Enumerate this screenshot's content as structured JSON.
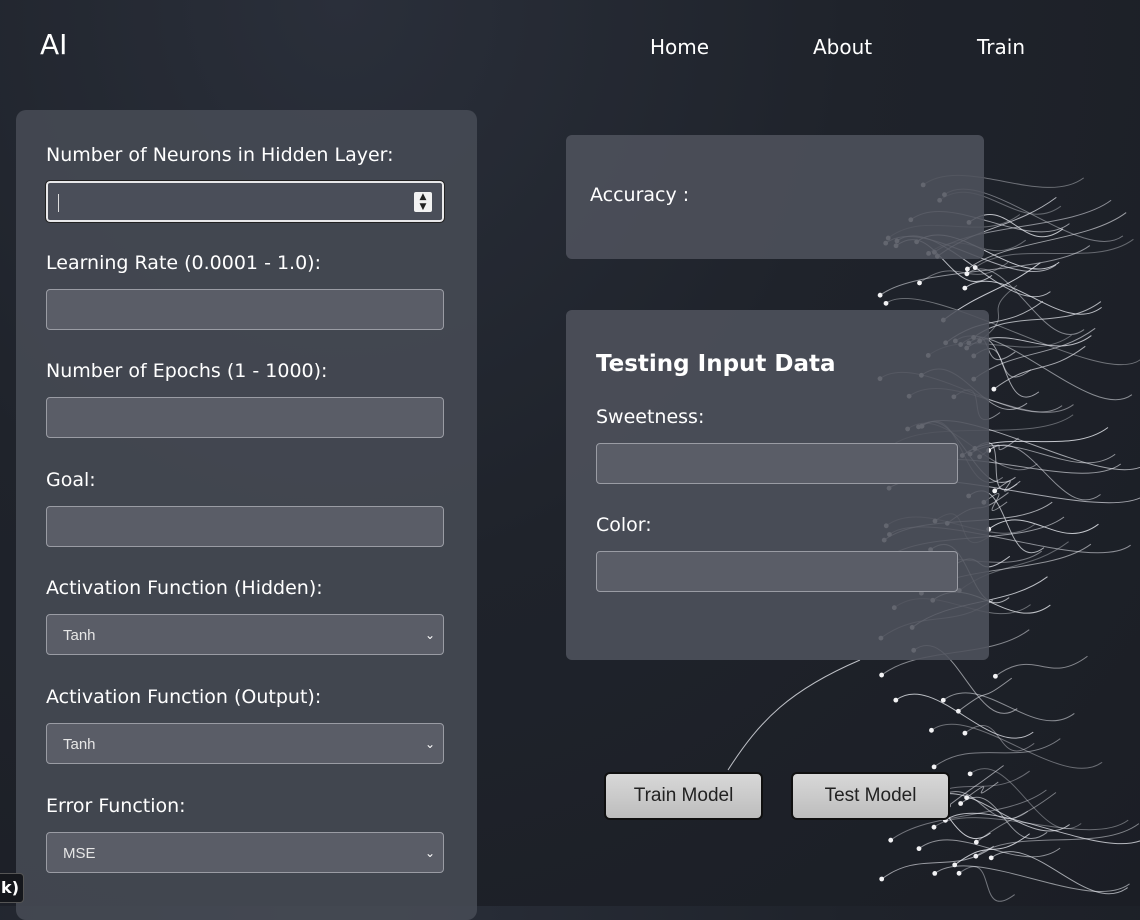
{
  "header": {
    "logo": "AI",
    "nav": [
      "Home",
      "About",
      "Train"
    ]
  },
  "form": {
    "neurons_label": "Number of Neurons in Hidden Layer:",
    "neurons_value": "",
    "learning_rate_label": "Learning Rate (0.0001 - 1.0):",
    "epochs_label": "Number of Epochs (1 - 1000):",
    "goal_label": "Goal:",
    "activation_hidden_label": "Activation Function (Hidden):",
    "activation_hidden_value": "Tanh",
    "activation_output_label": "Activation Function (Output):",
    "activation_output_value": "Tanh",
    "error_function_label": "Error Function:",
    "error_function_value": "MSE"
  },
  "accuracy": {
    "label": "Accuracy :"
  },
  "testing": {
    "title": "Testing Input Data",
    "sweetness_label": "Sweetness:",
    "color_label": "Color:"
  },
  "buttons": {
    "train": "Train Model",
    "test": "Test Model"
  },
  "tooltip": {
    "text": "k)"
  },
  "colors": {
    "background": "#1f232b",
    "panel": "#484c56",
    "input": "#5a5d67",
    "button": "#cfcfcf"
  }
}
